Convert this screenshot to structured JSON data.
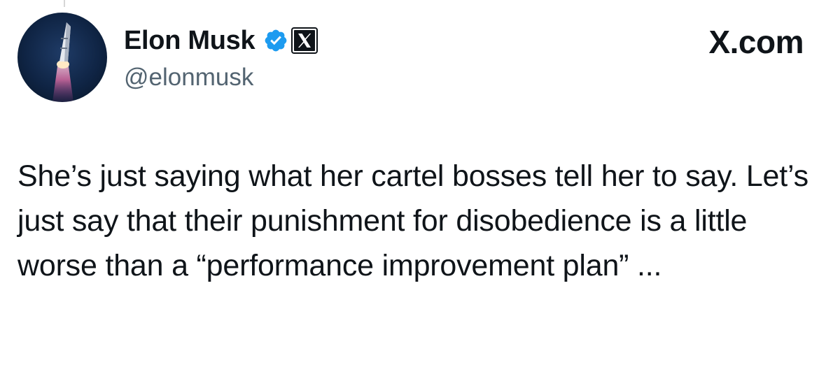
{
  "author": {
    "display_name": "Elon Musk",
    "handle": "@elonmusk",
    "avatar_alt": "rocket launch avatar",
    "verified_icon": "verified-check-icon",
    "affiliate_badge_icon": "x-logo-icon"
  },
  "brand": {
    "label": "X.com"
  },
  "tweet": {
    "text": "She’s just saying what her cartel bosses tell her to say. Let’s just say that their punishment for disobedience is a little worse than a “performance improvement plan” ..."
  },
  "colors": {
    "text": "#0f1419",
    "secondary_text": "#536471",
    "verified_blue": "#1d9bf0",
    "background": "#ffffff"
  }
}
